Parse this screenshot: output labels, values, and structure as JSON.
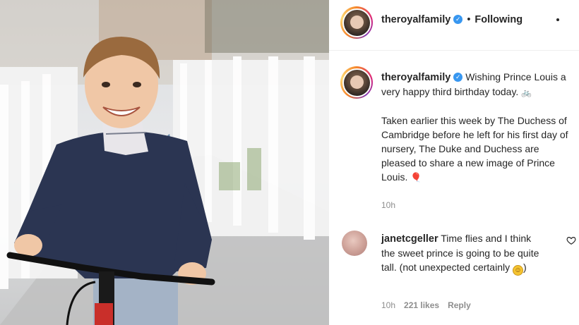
{
  "post": {
    "username": "theroyalfamily",
    "verified_icon": "verified-check-icon",
    "separator": "•",
    "follow_status": "Following",
    "photo_alt_icon": "photo-boy-on-bicycle"
  },
  "caption": {
    "username": "theroyalfamily",
    "line1": "Wishing Prince Louis a very happy third birthday today.",
    "emoji1": "🚲",
    "paragraph2": "Taken earlier this week by The Duchess of Cambridge before he left for his first day of nursery, The Duke and Duchess are pleased to share a new image of Prince Louis.",
    "emoji2": "🎈",
    "time": "10h"
  },
  "comment": {
    "username": "janetcgeller",
    "text": "Time flies and I think the sweet prince is going to be quite tall. (not unexpected certainly",
    "emoji": "☺",
    "closing": ")",
    "time": "10h",
    "likes": "221 likes",
    "reply": "Reply"
  },
  "colors": {
    "accent_blue": "#3897f0",
    "muted_text": "#8e8e8e",
    "primary_text": "#262626"
  }
}
